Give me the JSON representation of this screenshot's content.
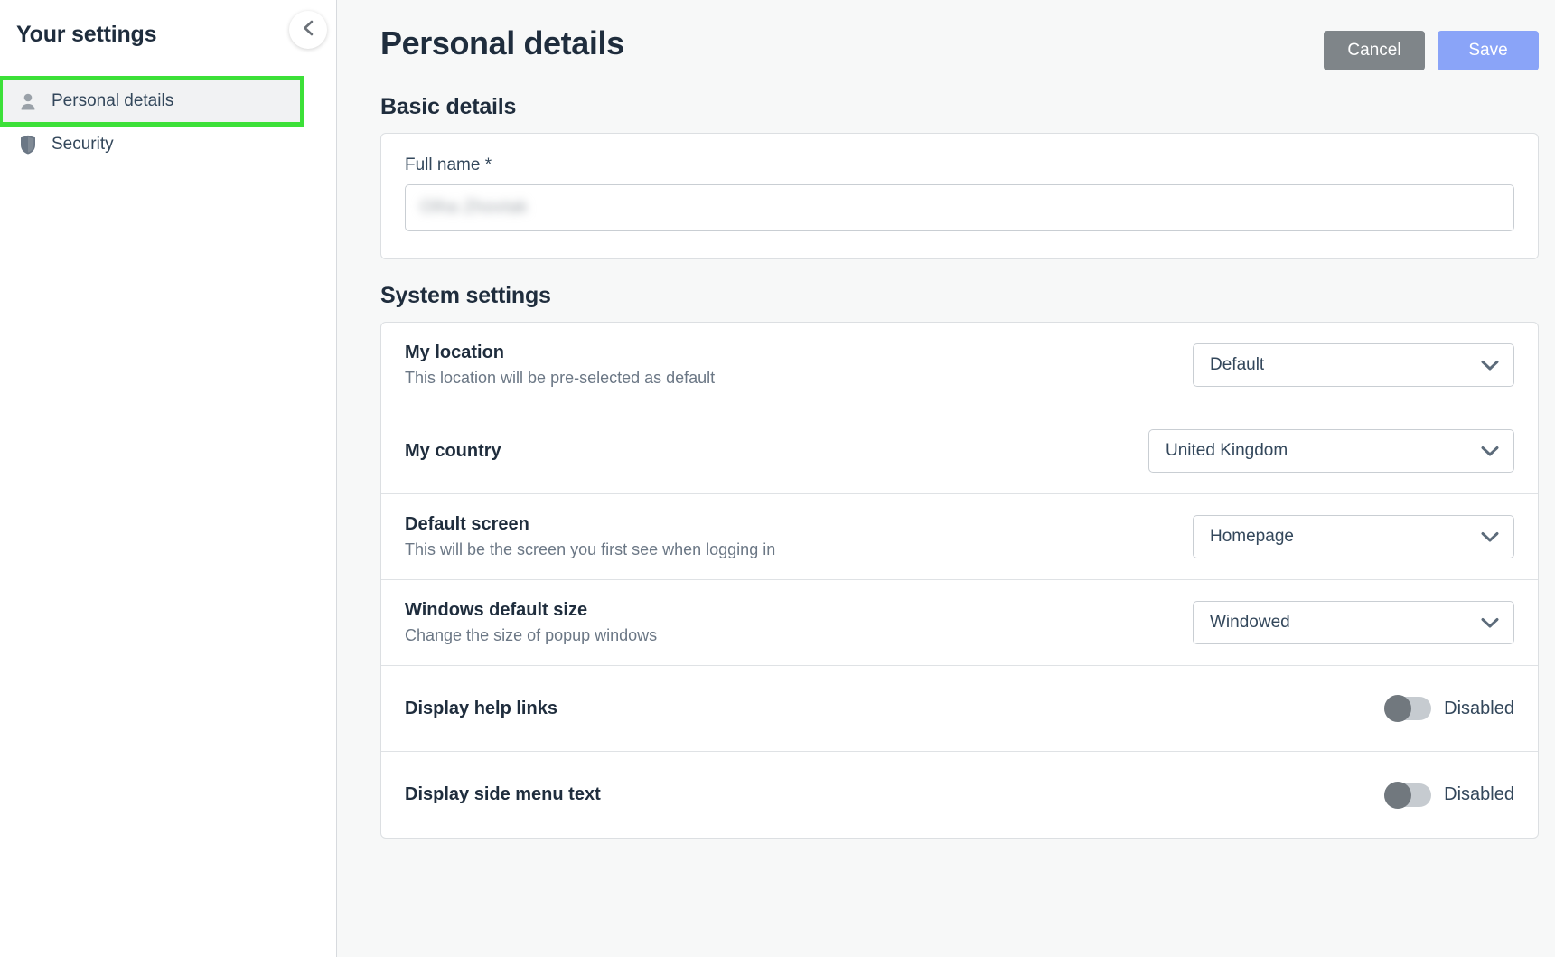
{
  "sidebar": {
    "title": "Your settings",
    "collapse_icon": "chevron-left-icon",
    "items": [
      {
        "label": "Personal details",
        "icon": "user-icon",
        "active": true
      },
      {
        "label": "Security",
        "icon": "shield-icon",
        "active": false
      }
    ]
  },
  "header": {
    "title": "Personal details",
    "cancel_label": "Cancel",
    "save_label": "Save"
  },
  "basic_details": {
    "section_title": "Basic details",
    "full_name": {
      "label": "Full name *",
      "value": "Olha Zhovtak",
      "placeholder": "Full name"
    }
  },
  "system_settings": {
    "section_title": "System settings",
    "rows": [
      {
        "title": "My location",
        "description": "This location will be pre-selected as default",
        "control": "select",
        "value": "Default",
        "icon": "chevron-down-icon"
      },
      {
        "title": "My country",
        "description": "",
        "control": "select",
        "value": "United Kingdom",
        "icon": "chevron-down-icon"
      },
      {
        "title": "Default screen",
        "description": "This will be the screen you first see when logging in",
        "control": "select",
        "value": "Homepage",
        "icon": "chevron-down-icon"
      },
      {
        "title": "Windows default size",
        "description": "Change the size of popup windows",
        "control": "select",
        "value": "Windowed",
        "icon": "chevron-down-icon"
      },
      {
        "title": "Display help links",
        "description": "",
        "control": "toggle",
        "value": "Disabled",
        "toggle_on": false
      },
      {
        "title": "Display side menu text",
        "description": "",
        "control": "toggle",
        "value": "Disabled",
        "toggle_on": false
      }
    ]
  },
  "colors": {
    "page_background": "#f7f8f8",
    "sidebar_background": "#ffffff",
    "highlight_outline": "#3ce038",
    "cancel_button": "#7f8589",
    "save_button": "#8aa4f8",
    "text_primary": "#1f2d3d",
    "text_secondary": "#6b7785",
    "toggle_track": "#c6cbd0",
    "toggle_knob": "#71787e"
  }
}
